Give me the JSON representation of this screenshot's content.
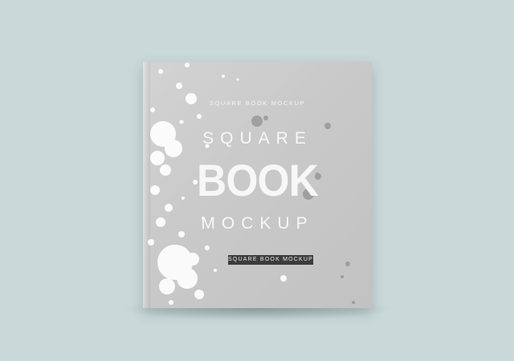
{
  "cover": {
    "small_title": "SQUARE BOOK MOCKUP",
    "word_1": "SQUARE",
    "word_2": "BOOK",
    "word_3": "MOCKUP",
    "tag_label": "SQUARE BOOK MOCKUP"
  },
  "colors": {
    "background": "#c9d8d9",
    "cover": "#cbcbcb",
    "tag": "#3c3c3c"
  }
}
